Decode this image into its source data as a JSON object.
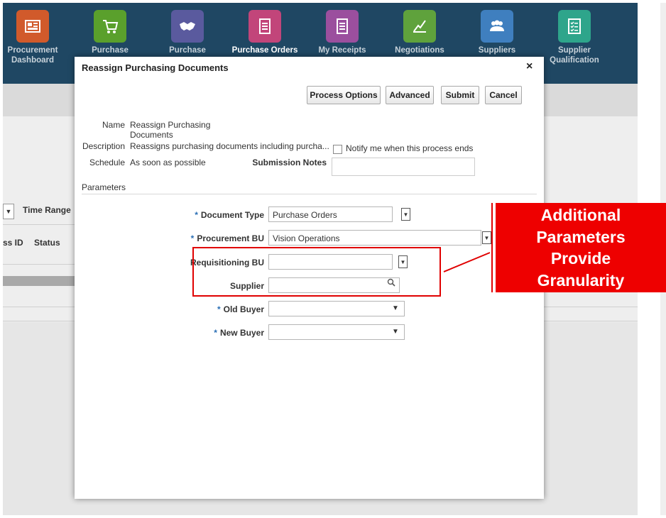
{
  "nav": {
    "items": [
      {
        "label": "Procurement Dashboard",
        "icon": "dashboard-icon",
        "color": "#d15a2b"
      },
      {
        "label": "Purchase",
        "icon": "cart-icon",
        "color": "#5aa02c"
      },
      {
        "label": "Purchase",
        "icon": "handshake-icon",
        "color": "#5a5a9e"
      },
      {
        "label": "Purchase Orders",
        "icon": "document-icon",
        "color": "#c2457a"
      },
      {
        "label": "My Receipts",
        "icon": "receipt-icon",
        "color": "#9b4f9e"
      },
      {
        "label": "Negotiations",
        "icon": "negotiation-icon",
        "color": "#5fa23c"
      },
      {
        "label": "Suppliers",
        "icon": "group-icon",
        "color": "#3f7fbf"
      },
      {
        "label": "Supplier Qualification",
        "icon": "checklist-icon",
        "color": "#2ea58b"
      }
    ]
  },
  "background": {
    "time_range": "Time Range",
    "process_id": "ss ID",
    "status": "Status"
  },
  "dialog": {
    "title": "Reassign Purchasing Documents",
    "close": "×",
    "buttons": {
      "process_options": "Process Options",
      "advanced": "Advanced",
      "submit": "Submit",
      "cancel": "Cancel"
    },
    "name_label": "Name",
    "name_value_line1": "Reassign Purchasing",
    "name_value_line2": "Documents",
    "description_label": "Description",
    "description_value": "Reassigns purchasing documents including purcha...",
    "notify_label": "Notify me when this process ends",
    "schedule_label": "Schedule",
    "schedule_value": "As soon as possible",
    "submission_notes_label": "Submission Notes",
    "submission_notes_value": "",
    "parameters_label": "Parameters",
    "params": {
      "document_type_label": "Document Type",
      "document_type_value": "Purchase Orders",
      "procurement_bu_label": "Procurement BU",
      "procurement_bu_value": "Vision Operations",
      "requisitioning_bu_label": "Requisitioning BU",
      "requisitioning_bu_value": "",
      "supplier_label": "Supplier",
      "supplier_value": "",
      "old_buyer_label": "Old Buyer",
      "old_buyer_value": "",
      "new_buyer_label": "New Buyer",
      "new_buyer_value": ""
    }
  },
  "annotation": {
    "line1": "Additional",
    "line2": "Parameters",
    "line3": "Provide",
    "line4": "Granularity",
    "color": "#ee0000"
  }
}
